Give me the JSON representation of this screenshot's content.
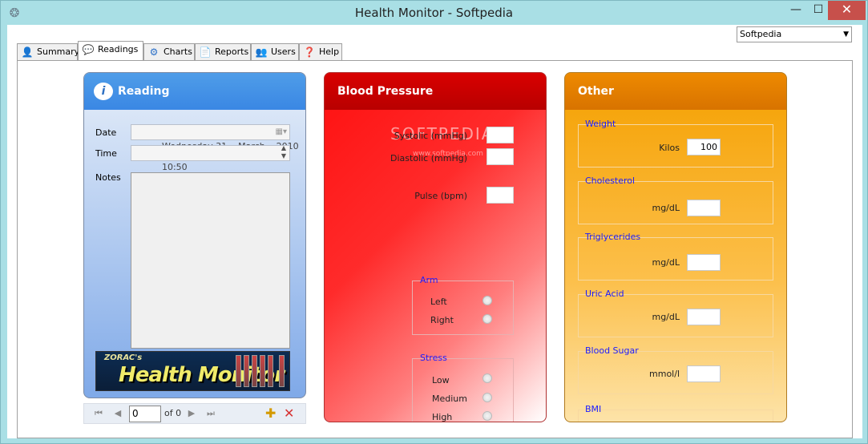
{
  "window": {
    "title": "Health Monitor - Softpedia",
    "min": "—",
    "max": "☐",
    "close": "✕"
  },
  "user_select": {
    "value": "Softpedia"
  },
  "tabs": [
    {
      "label": "Summary",
      "icon": "user-icon"
    },
    {
      "label": "Readings",
      "icon": "speech-bubble-icon"
    },
    {
      "label": "Charts",
      "icon": "gear-icon"
    },
    {
      "label": "Reports",
      "icon": "document-icon"
    },
    {
      "label": "Users",
      "icon": "users-icon"
    },
    {
      "label": "Help",
      "icon": "help-icon"
    }
  ],
  "reading": {
    "title": "Reading",
    "date_label": "Date",
    "date_value": "Wednesday 31    March    2010",
    "time_label": "Time",
    "time_value": "10:50",
    "notes_label": "Notes",
    "logo_small": "ZORAC's",
    "logo_big": "Health Monitor"
  },
  "navigator": {
    "position": "0",
    "of_text": "of 0"
  },
  "blood_pressure": {
    "title": "Blood Pressure",
    "watermark": "SOFTPEDIA",
    "watermark_url": "www.softpedia.com",
    "systolic_label": "Systolic (mmHg)",
    "diastolic_label": "Diastolic (mmHg)",
    "pulse_label": "Pulse (bpm)",
    "arm": {
      "title": "Arm",
      "options": [
        "Left",
        "Right"
      ]
    },
    "stress": {
      "title": "Stress",
      "options": [
        "Low",
        "Medium",
        "High"
      ]
    }
  },
  "other": {
    "title": "Other",
    "weight": {
      "title": "Weight",
      "unit": "Kilos",
      "value": "100"
    },
    "cholesterol": {
      "title": "Cholesterol",
      "unit": "mg/dL",
      "value": ""
    },
    "triglycerides": {
      "title": "Triglycerides",
      "unit": "mg/dL",
      "value": ""
    },
    "uric_acid": {
      "title": "Uric Acid",
      "unit": "mg/dL",
      "value": ""
    },
    "blood_sugar": {
      "title": "Blood Sugar",
      "unit": "mmol/l",
      "value": ""
    },
    "bmi": {
      "title": "BMI"
    }
  }
}
